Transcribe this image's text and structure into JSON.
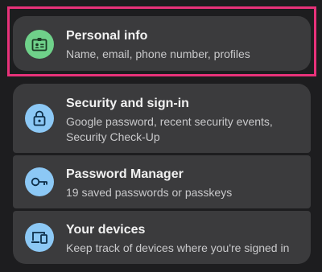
{
  "colors": {
    "page_background": "#1d1d1f",
    "card_background": "#3b3b3d",
    "highlight_border": "#e8327a",
    "personal_info_icon_bg": "#6fd18a",
    "blue_icon_bg": "#8cc8f5"
  },
  "cards": [
    {
      "title": "Personal info",
      "description": "Name, email, phone number, profiles",
      "icon": "id-card-icon",
      "highlighted": true
    },
    {
      "title": "Security and sign-in",
      "description_line1": "Google password, recent security events,",
      "description_line2": "Security Check-Up",
      "icon": "lock-icon"
    },
    {
      "title": "Password Manager",
      "description": "19 saved passwords or passkeys",
      "icon": "key-icon"
    },
    {
      "title": "Your devices",
      "description": "Keep track of devices where you're signed in",
      "icon": "devices-icon"
    }
  ]
}
